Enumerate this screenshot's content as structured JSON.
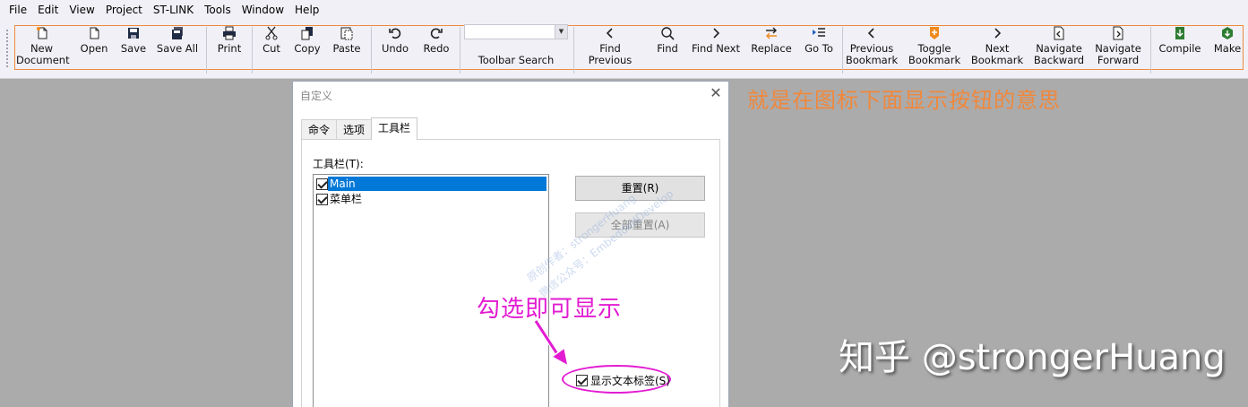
{
  "menu": [
    "File",
    "Edit",
    "View",
    "Project",
    "ST-LINK",
    "Tools",
    "Window",
    "Help"
  ],
  "toolbar": {
    "buttons": [
      {
        "label": "New\nDocument",
        "icon": "new-document-icon"
      },
      {
        "label": "Open",
        "icon": "open-icon"
      },
      {
        "label": "Save",
        "icon": "save-icon"
      },
      {
        "label": "Save All",
        "icon": "save-all-icon"
      },
      {
        "label": "Print",
        "icon": "print-icon"
      },
      {
        "label": "Cut",
        "icon": "cut-icon"
      },
      {
        "label": "Copy",
        "icon": "copy-icon"
      },
      {
        "label": "Paste",
        "icon": "paste-icon"
      },
      {
        "label": "Undo",
        "icon": "undo-icon"
      },
      {
        "label": "Redo",
        "icon": "redo-icon"
      },
      {
        "label": "Find Previous",
        "icon": "chevron-left-icon"
      },
      {
        "label": "Find",
        "icon": "magnifier-icon"
      },
      {
        "label": "Find Next",
        "icon": "chevron-right-icon"
      },
      {
        "label": "Replace",
        "icon": "replace-icon"
      },
      {
        "label": "Go To",
        "icon": "goto-icon"
      },
      {
        "label": "Previous\nBookmark",
        "icon": "chevron-left-icon"
      },
      {
        "label": "Toggle\nBookmark",
        "icon": "bookmark-icon"
      },
      {
        "label": "Next\nBookmark",
        "icon": "chevron-right-icon"
      },
      {
        "label": "Navigate\nBackward",
        "icon": "navigate-backward-icon"
      },
      {
        "label": "Navigate\nForward",
        "icon": "navigate-forward-icon"
      },
      {
        "label": "Compile",
        "icon": "compile-icon"
      },
      {
        "label": "Make",
        "icon": "make-icon"
      }
    ],
    "search_label": "Toolbar Search",
    "search_value": ""
  },
  "annotations": {
    "top": "就是在图标下面显示按钮的意思",
    "check": "勾选即可显示",
    "watermark": "知乎 @strongerHuang"
  },
  "dialog": {
    "title": "自定义",
    "tabs": [
      "命令",
      "选项",
      "工具栏"
    ],
    "active_tab": "工具栏",
    "list_label": "工具栏(T):",
    "list_items": [
      {
        "label": "Main",
        "checked": true,
        "selected": true
      },
      {
        "label": "菜单栏",
        "checked": true,
        "selected": false
      }
    ],
    "reset_button": "重置(R)",
    "reset_all_button": "全部重置(A)",
    "show_text_label": "显示文本标签(S)",
    "show_text_checked": true,
    "watermark_lines": [
      "原创作者：strongerHuang",
      "微信公众号：EmbeddedDevelop"
    ]
  },
  "colors": {
    "toolbar_outline": "#f08a3c",
    "annotation_orange": "#f0883c",
    "annotation_magenta": "#e21cd2",
    "selection": "#0078d7"
  }
}
